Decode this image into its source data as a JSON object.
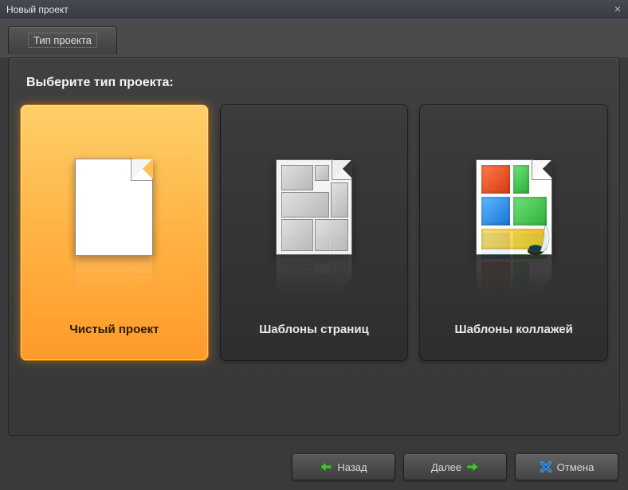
{
  "window": {
    "title": "Новый проект"
  },
  "tabs": {
    "project_type": "Тип проекта"
  },
  "heading": "Выберите тип проекта:",
  "cards": {
    "blank": "Чистый проект",
    "page_templates": "Шаблоны страниц",
    "collage_templates": "Шаблоны коллажей"
  },
  "footer": {
    "back": "Назад",
    "next": "Далее",
    "cancel": "Отмена"
  },
  "icons": {
    "back_arrow": "arrow-left-icon",
    "next_arrow": "arrow-right-icon",
    "cancel_x": "cancel-x-icon"
  },
  "colors": {
    "selected_gradient_top": "#ffcf6a",
    "selected_gradient_bottom": "#ff9a29"
  }
}
